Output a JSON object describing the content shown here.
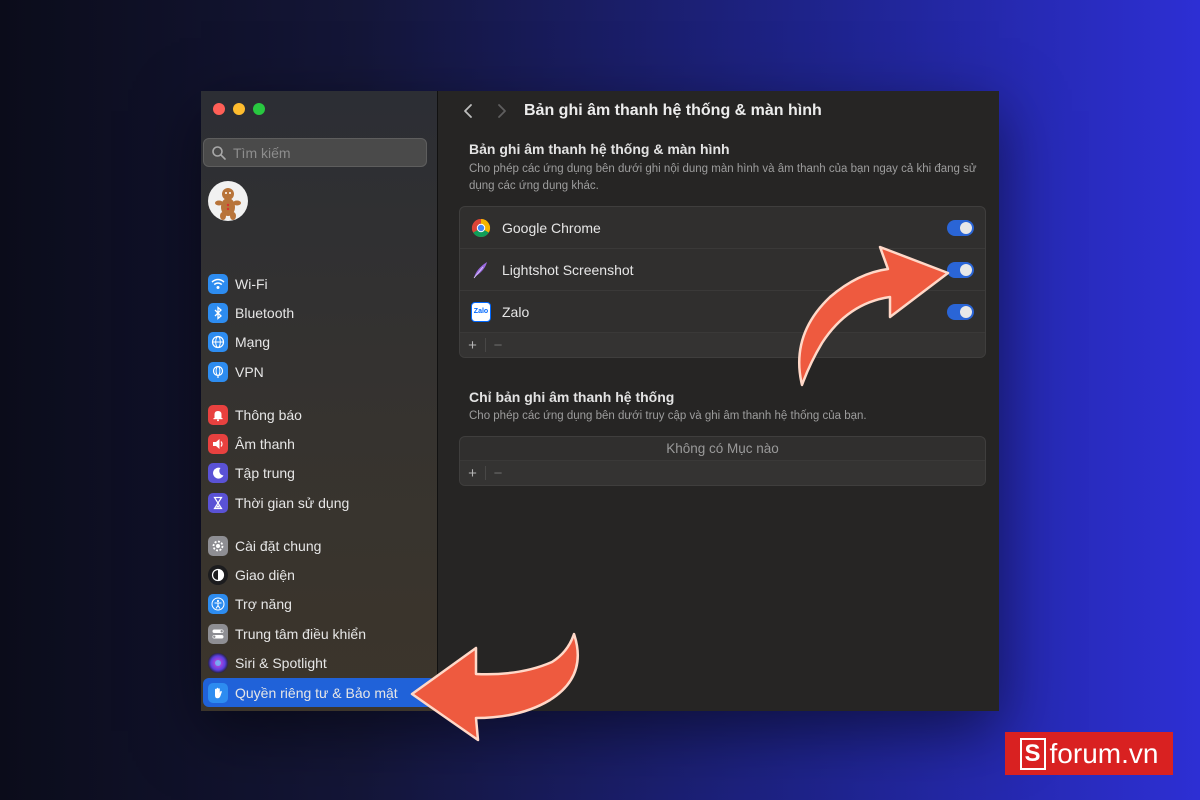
{
  "window": {
    "traffic_lights": [
      "close",
      "minimize",
      "zoom"
    ]
  },
  "sidebar": {
    "search_placeholder": "Tìm kiếm",
    "avatar_icon": "gingerbread-avatar",
    "groups": [
      [
        {
          "label": "Wi-Fi",
          "icon": "wifi-icon",
          "color": "#2d8cf0"
        },
        {
          "label": "Bluetooth",
          "icon": "bluetooth-icon",
          "color": "#2d8cf0"
        },
        {
          "label": "Mạng",
          "icon": "globe-icon",
          "color": "#2d8cf0"
        },
        {
          "label": "VPN",
          "icon": "vpn-globe-icon",
          "color": "#2d8cf0"
        }
      ],
      [
        {
          "label": "Thông báo",
          "icon": "notification-bell-icon",
          "color": "#e8413f"
        },
        {
          "label": "Âm thanh",
          "icon": "speaker-icon",
          "color": "#e8413f"
        },
        {
          "label": "Tập trung",
          "icon": "moon-icon",
          "color": "#5a52d5"
        },
        {
          "label": "Thời gian sử dụng",
          "icon": "hourglass-icon",
          "color": "#5a52d5"
        }
      ],
      [
        {
          "label": "Cài đặt chung",
          "icon": "gear-icon",
          "color": "#8e8e93"
        },
        {
          "label": "Giao diện",
          "icon": "appearance-icon",
          "color": "#1c1c1e"
        },
        {
          "label": "Trợ năng",
          "icon": "accessibility-icon",
          "color": "#2d8cf0"
        },
        {
          "label": "Trung tâm điều khiển",
          "icon": "control-center-icon",
          "color": "#8e8e93"
        },
        {
          "label": "Siri & Spotlight",
          "icon": "siri-icon",
          "color": "#2a2a3a"
        },
        {
          "label": "Quyền riêng tư & Bảo mật",
          "icon": "hand-icon",
          "color": "#2d8cf0",
          "active": true
        }
      ]
    ]
  },
  "toolbar": {
    "title": "Bản ghi âm thanh hệ thống & màn hình"
  },
  "section1": {
    "title": "Bản ghi âm thanh hệ thống & màn hình",
    "description": "Cho phép các ứng dụng bên dưới ghi nội dung màn hình và âm thanh của bạn ngay cả khi đang sử dụng các ứng dụng khác.",
    "apps": [
      {
        "name": "Google Chrome",
        "icon": "chrome-icon",
        "enabled": true
      },
      {
        "name": "Lightshot Screenshot",
        "icon": "lightshot-feather-icon",
        "enabled": true
      },
      {
        "name": "Zalo",
        "icon": "zalo-icon",
        "icon_text": "Zalo",
        "enabled": true
      }
    ],
    "add_label": "+",
    "remove_label": "−"
  },
  "section2": {
    "title": "Chỉ bản ghi âm thanh hệ thống",
    "description": "Cho phép các ứng dụng bên dưới truy cập và ghi âm thanh hệ thống của bạn.",
    "empty_text": "Không có Mục nào",
    "add_label": "+",
    "remove_label": "−"
  },
  "brand": {
    "icon_letter": "S",
    "text": "forum.vn",
    "color": "#d92121"
  },
  "colors": {
    "accent": "#2062d9",
    "arrow": "#ee5a3f"
  }
}
